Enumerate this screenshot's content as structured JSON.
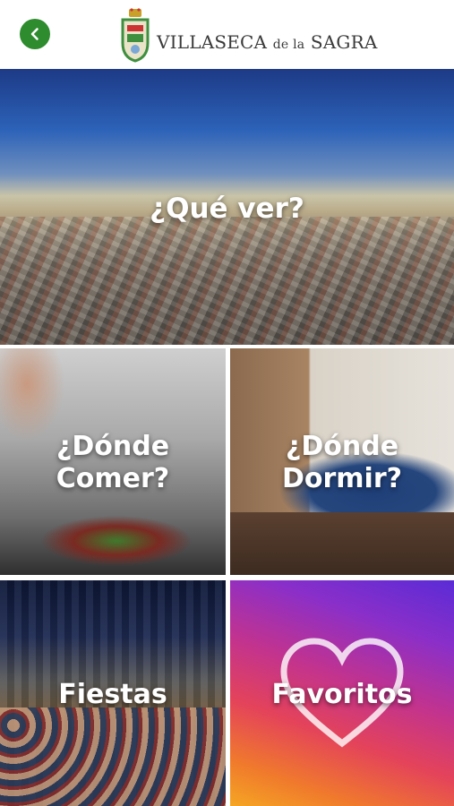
{
  "header": {
    "logo_text_1": "VILLASECA",
    "logo_text_2": "de la",
    "logo_text_3": "SAGRA"
  },
  "tiles": [
    {
      "label": "¿Qué ver?"
    },
    {
      "label_line1": "¿Dónde",
      "label_line2": "Comer?"
    },
    {
      "label_line1": "¿Dónde",
      "label_line2": "Dormir?"
    },
    {
      "label": "Fiestas"
    },
    {
      "label": "Favoritos"
    }
  ],
  "colors": {
    "back_button": "#2e8b2e",
    "label_text": "#ffffff"
  },
  "icons": {
    "back": "chevron-left-icon",
    "crest": "coat-of-arms-icon",
    "favorites": "heart-icon"
  }
}
